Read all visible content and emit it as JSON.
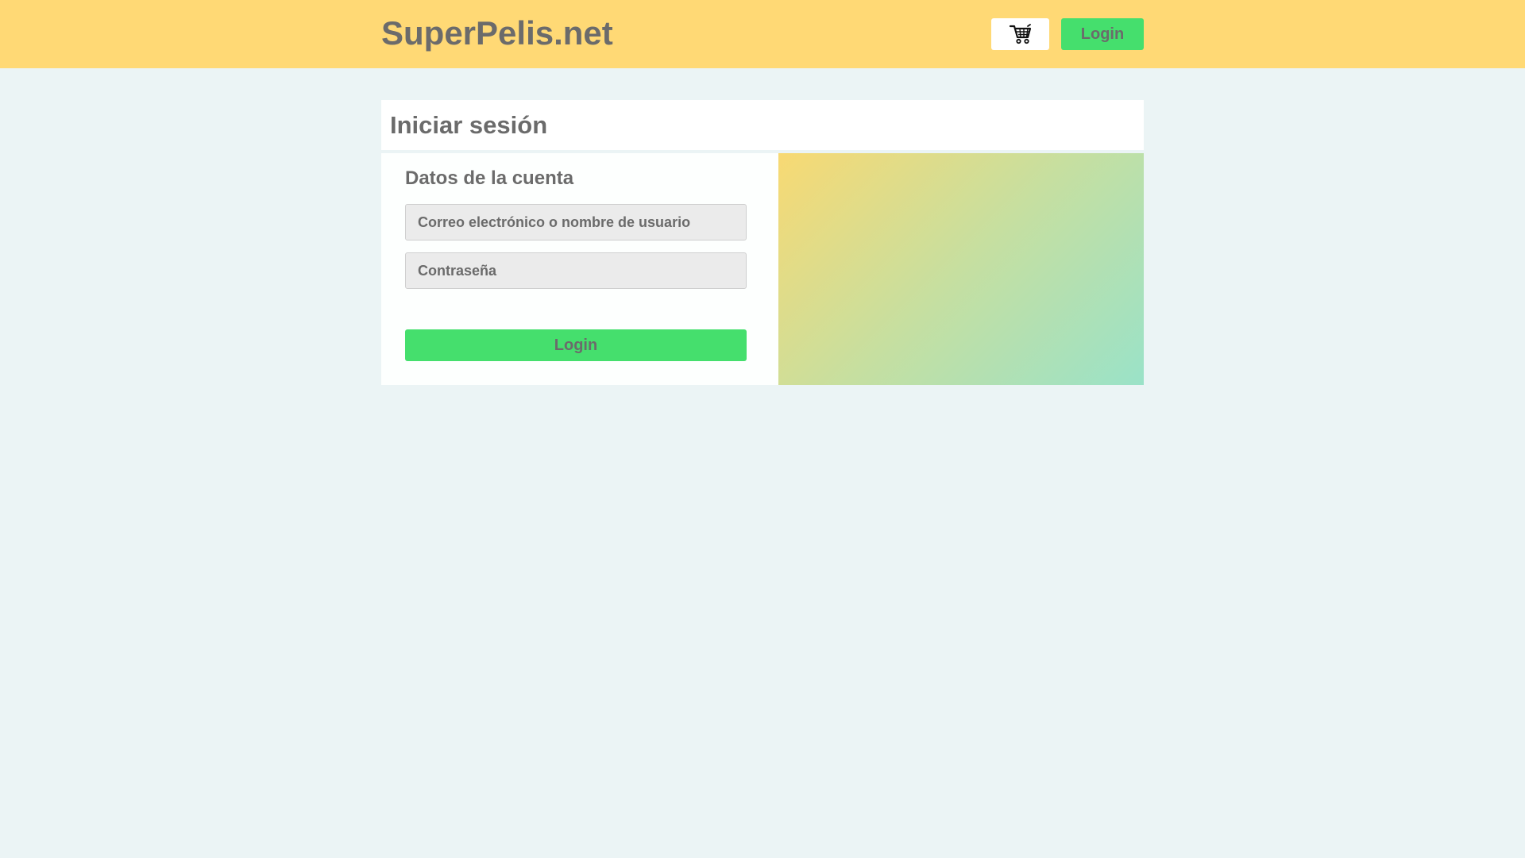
{
  "header": {
    "brand": "SuperPelis.net",
    "cart_icon": "shopping-cart-icon",
    "login_label": "Login"
  },
  "page": {
    "title": "Iniciar sesión"
  },
  "form": {
    "section_title": "Datos de la cuenta",
    "email_placeholder": "Correo electrónico o nombre de usuario",
    "password_placeholder": "Contraseña",
    "submit_label": "Login"
  },
  "colors": {
    "topbar": "#ffd975",
    "background": "#ebf4f5",
    "accent": "#45df6d",
    "text": "#6b6b6b",
    "gradient_start": "#f8d973",
    "gradient_end": "#9ae2c8"
  }
}
